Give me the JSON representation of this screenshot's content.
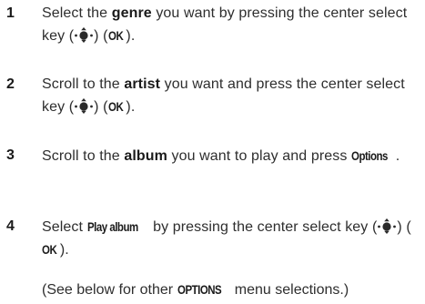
{
  "steps": [
    {
      "number": "1",
      "t1": "Select the ",
      "b1": "genre",
      "t2": " you want by pressing the center select key (",
      "t3": ") (",
      "k1": "OK",
      "t4": ")."
    },
    {
      "number": "2",
      "t1": "Scroll to the ",
      "b1": "artist",
      "t2": " you want and press the center select key (",
      "t3": ") (",
      "k1": "OK",
      "t4": ")."
    },
    {
      "number": "3",
      "t1": "Scroll to the ",
      "b1": "album",
      "t2": " you want to play and press ",
      "k1": "Options",
      "t4": "."
    },
    {
      "number": "4",
      "t1": "Select ",
      "k1": "Play album",
      "t2": " by pressing the center select key (",
      "t3": ") (",
      "k2": "OK",
      "t4": ")."
    }
  ],
  "note": {
    "t1": "(See below for other ",
    "k1": "OPTIONS",
    "t2": " menu selections.)"
  },
  "icons": {
    "center_select_key": "center-select-key-icon"
  },
  "colors": {
    "text": "#2e2e2e",
    "emphasis": "#1a1a1a",
    "background": "#ffffff"
  }
}
